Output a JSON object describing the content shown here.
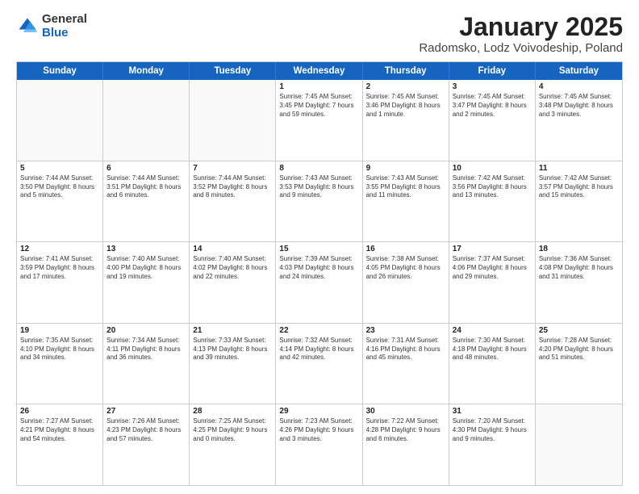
{
  "logo": {
    "general": "General",
    "blue": "Blue"
  },
  "title": "January 2025",
  "subtitle": "Radomsko, Lodz Voivodeship, Poland",
  "days": [
    "Sunday",
    "Monday",
    "Tuesday",
    "Wednesday",
    "Thursday",
    "Friday",
    "Saturday"
  ],
  "weeks": [
    [
      {
        "day": "",
        "text": "",
        "empty": true
      },
      {
        "day": "",
        "text": "",
        "empty": true
      },
      {
        "day": "",
        "text": "",
        "empty": true
      },
      {
        "day": "1",
        "text": "Sunrise: 7:45 AM\nSunset: 3:45 PM\nDaylight: 7 hours\nand 59 minutes."
      },
      {
        "day": "2",
        "text": "Sunrise: 7:45 AM\nSunset: 3:46 PM\nDaylight: 8 hours\nand 1 minute."
      },
      {
        "day": "3",
        "text": "Sunrise: 7:45 AM\nSunset: 3:47 PM\nDaylight: 8 hours\nand 2 minutes."
      },
      {
        "day": "4",
        "text": "Sunrise: 7:45 AM\nSunset: 3:48 PM\nDaylight: 8 hours\nand 3 minutes."
      }
    ],
    [
      {
        "day": "5",
        "text": "Sunrise: 7:44 AM\nSunset: 3:50 PM\nDaylight: 8 hours\nand 5 minutes."
      },
      {
        "day": "6",
        "text": "Sunrise: 7:44 AM\nSunset: 3:51 PM\nDaylight: 8 hours\nand 6 minutes."
      },
      {
        "day": "7",
        "text": "Sunrise: 7:44 AM\nSunset: 3:52 PM\nDaylight: 8 hours\nand 8 minutes."
      },
      {
        "day": "8",
        "text": "Sunrise: 7:43 AM\nSunset: 3:53 PM\nDaylight: 8 hours\nand 9 minutes."
      },
      {
        "day": "9",
        "text": "Sunrise: 7:43 AM\nSunset: 3:55 PM\nDaylight: 8 hours\nand 11 minutes."
      },
      {
        "day": "10",
        "text": "Sunrise: 7:42 AM\nSunset: 3:56 PM\nDaylight: 8 hours\nand 13 minutes."
      },
      {
        "day": "11",
        "text": "Sunrise: 7:42 AM\nSunset: 3:57 PM\nDaylight: 8 hours\nand 15 minutes."
      }
    ],
    [
      {
        "day": "12",
        "text": "Sunrise: 7:41 AM\nSunset: 3:59 PM\nDaylight: 8 hours\nand 17 minutes."
      },
      {
        "day": "13",
        "text": "Sunrise: 7:40 AM\nSunset: 4:00 PM\nDaylight: 8 hours\nand 19 minutes."
      },
      {
        "day": "14",
        "text": "Sunrise: 7:40 AM\nSunset: 4:02 PM\nDaylight: 8 hours\nand 22 minutes."
      },
      {
        "day": "15",
        "text": "Sunrise: 7:39 AM\nSunset: 4:03 PM\nDaylight: 8 hours\nand 24 minutes."
      },
      {
        "day": "16",
        "text": "Sunrise: 7:38 AM\nSunset: 4:05 PM\nDaylight: 8 hours\nand 26 minutes."
      },
      {
        "day": "17",
        "text": "Sunrise: 7:37 AM\nSunset: 4:06 PM\nDaylight: 8 hours\nand 29 minutes."
      },
      {
        "day": "18",
        "text": "Sunrise: 7:36 AM\nSunset: 4:08 PM\nDaylight: 8 hours\nand 31 minutes."
      }
    ],
    [
      {
        "day": "19",
        "text": "Sunrise: 7:35 AM\nSunset: 4:10 PM\nDaylight: 8 hours\nand 34 minutes."
      },
      {
        "day": "20",
        "text": "Sunrise: 7:34 AM\nSunset: 4:11 PM\nDaylight: 8 hours\nand 36 minutes."
      },
      {
        "day": "21",
        "text": "Sunrise: 7:33 AM\nSunset: 4:13 PM\nDaylight: 8 hours\nand 39 minutes."
      },
      {
        "day": "22",
        "text": "Sunrise: 7:32 AM\nSunset: 4:14 PM\nDaylight: 8 hours\nand 42 minutes."
      },
      {
        "day": "23",
        "text": "Sunrise: 7:31 AM\nSunset: 4:16 PM\nDaylight: 8 hours\nand 45 minutes."
      },
      {
        "day": "24",
        "text": "Sunrise: 7:30 AM\nSunset: 4:18 PM\nDaylight: 8 hours\nand 48 minutes."
      },
      {
        "day": "25",
        "text": "Sunrise: 7:28 AM\nSunset: 4:20 PM\nDaylight: 8 hours\nand 51 minutes."
      }
    ],
    [
      {
        "day": "26",
        "text": "Sunrise: 7:27 AM\nSunset: 4:21 PM\nDaylight: 8 hours\nand 54 minutes."
      },
      {
        "day": "27",
        "text": "Sunrise: 7:26 AM\nSunset: 4:23 PM\nDaylight: 8 hours\nand 57 minutes."
      },
      {
        "day": "28",
        "text": "Sunrise: 7:25 AM\nSunset: 4:25 PM\nDaylight: 9 hours\nand 0 minutes."
      },
      {
        "day": "29",
        "text": "Sunrise: 7:23 AM\nSunset: 4:26 PM\nDaylight: 9 hours\nand 3 minutes."
      },
      {
        "day": "30",
        "text": "Sunrise: 7:22 AM\nSunset: 4:28 PM\nDaylight: 9 hours\nand 6 minutes."
      },
      {
        "day": "31",
        "text": "Sunrise: 7:20 AM\nSunset: 4:30 PM\nDaylight: 9 hours\nand 9 minutes."
      },
      {
        "day": "",
        "text": "",
        "empty": true
      }
    ]
  ]
}
